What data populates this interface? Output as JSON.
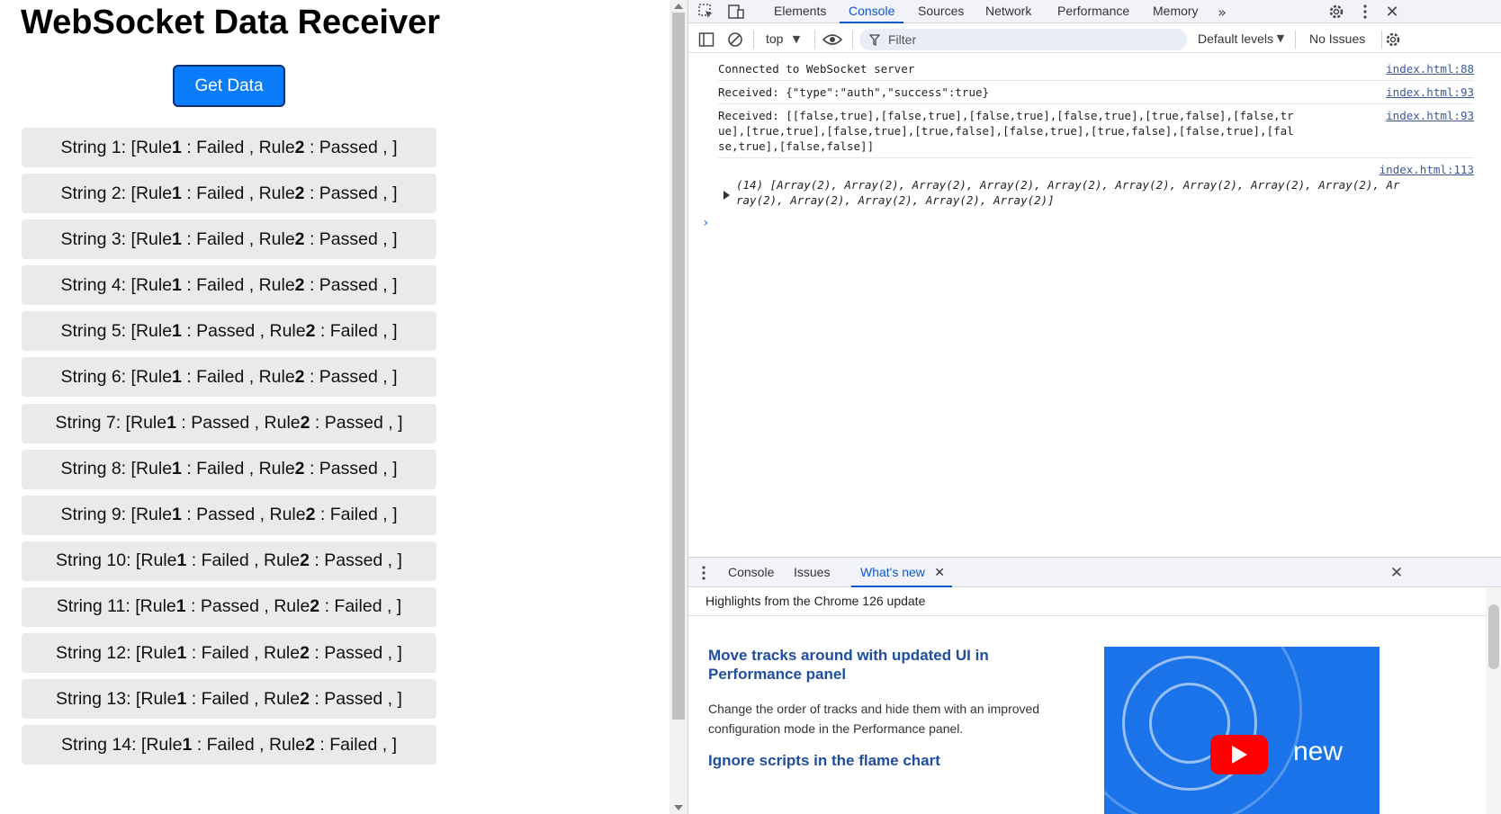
{
  "page": {
    "title": "WebSocket Data Receiver",
    "button_label": "Get Data",
    "results": [
      {
        "label": "String 1:",
        "r1": "Failed",
        "r2": "Passed"
      },
      {
        "label": "String 2:",
        "r1": "Failed",
        "r2": "Passed"
      },
      {
        "label": "String 3:",
        "r1": "Failed",
        "r2": "Passed"
      },
      {
        "label": "String 4:",
        "r1": "Failed",
        "r2": "Passed"
      },
      {
        "label": "String 5:",
        "r1": "Passed",
        "r2": "Failed"
      },
      {
        "label": "String 6:",
        "r1": "Failed",
        "r2": "Passed"
      },
      {
        "label": "String 7:",
        "r1": "Passed",
        "r2": "Passed"
      },
      {
        "label": "String 8:",
        "r1": "Failed",
        "r2": "Passed"
      },
      {
        "label": "String 9:",
        "r1": "Passed",
        "r2": "Failed"
      },
      {
        "label": "String 10:",
        "r1": "Failed",
        "r2": "Passed"
      },
      {
        "label": "String 11:",
        "r1": "Passed",
        "r2": "Failed"
      },
      {
        "label": "String 12:",
        "r1": "Failed",
        "r2": "Passed"
      },
      {
        "label": "String 13:",
        "r1": "Failed",
        "r2": "Passed"
      },
      {
        "label": "String 14:",
        "r1": "Failed",
        "r2": "Failed"
      }
    ],
    "rule_word": "Rule",
    "rule1_num": "1",
    "rule2_num": "2"
  },
  "devtools": {
    "tabs": [
      "Elements",
      "Console",
      "Sources",
      "Network",
      "Performance",
      "Memory"
    ],
    "active_tab": "Console",
    "console_toolbar": {
      "context": "top",
      "filter_placeholder": "Filter",
      "levels": "Default levels",
      "issues": "No Issues"
    },
    "messages": [
      {
        "text": "Connected to WebSocket server",
        "source": "index.html:88"
      },
      {
        "text": "Received: {\"type\":\"auth\",\"success\":true}",
        "source": "index.html:93"
      },
      {
        "text": "Received: [[false,true],[false,true],[false,true],[false,true],[true,false],[false,true],[true,true],[false,true],[true,false],[false,true],[true,false],[false,true],[false,true],[false,false]]",
        "source": "index.html:93"
      },
      {
        "text": "(14) [Array(2), Array(2), Array(2), Array(2), Array(2), Array(2), Array(2), Array(2), Array(2), Array(2), Array(2), Array(2), Array(2), Array(2)]",
        "source": "index.html:113"
      }
    ],
    "drawer": {
      "tabs": [
        "Console",
        "Issues",
        "What's new"
      ],
      "active_tab": "What's new",
      "highlights": "Highlights from the Chrome 126 update",
      "feature_title": "Move tracks around with updated UI in Performance panel",
      "feature_desc": "Change the order of tracks and hide them with an improved configuration mode in the Performance panel.",
      "feature2_title": "Ignore scripts in the flame chart",
      "promo_text": "new"
    }
  },
  "colors": {
    "button_blue": "#0b7dfa",
    "active_tab_blue": "#0b57d0",
    "feature_title_blue": "#1f4ea1"
  }
}
